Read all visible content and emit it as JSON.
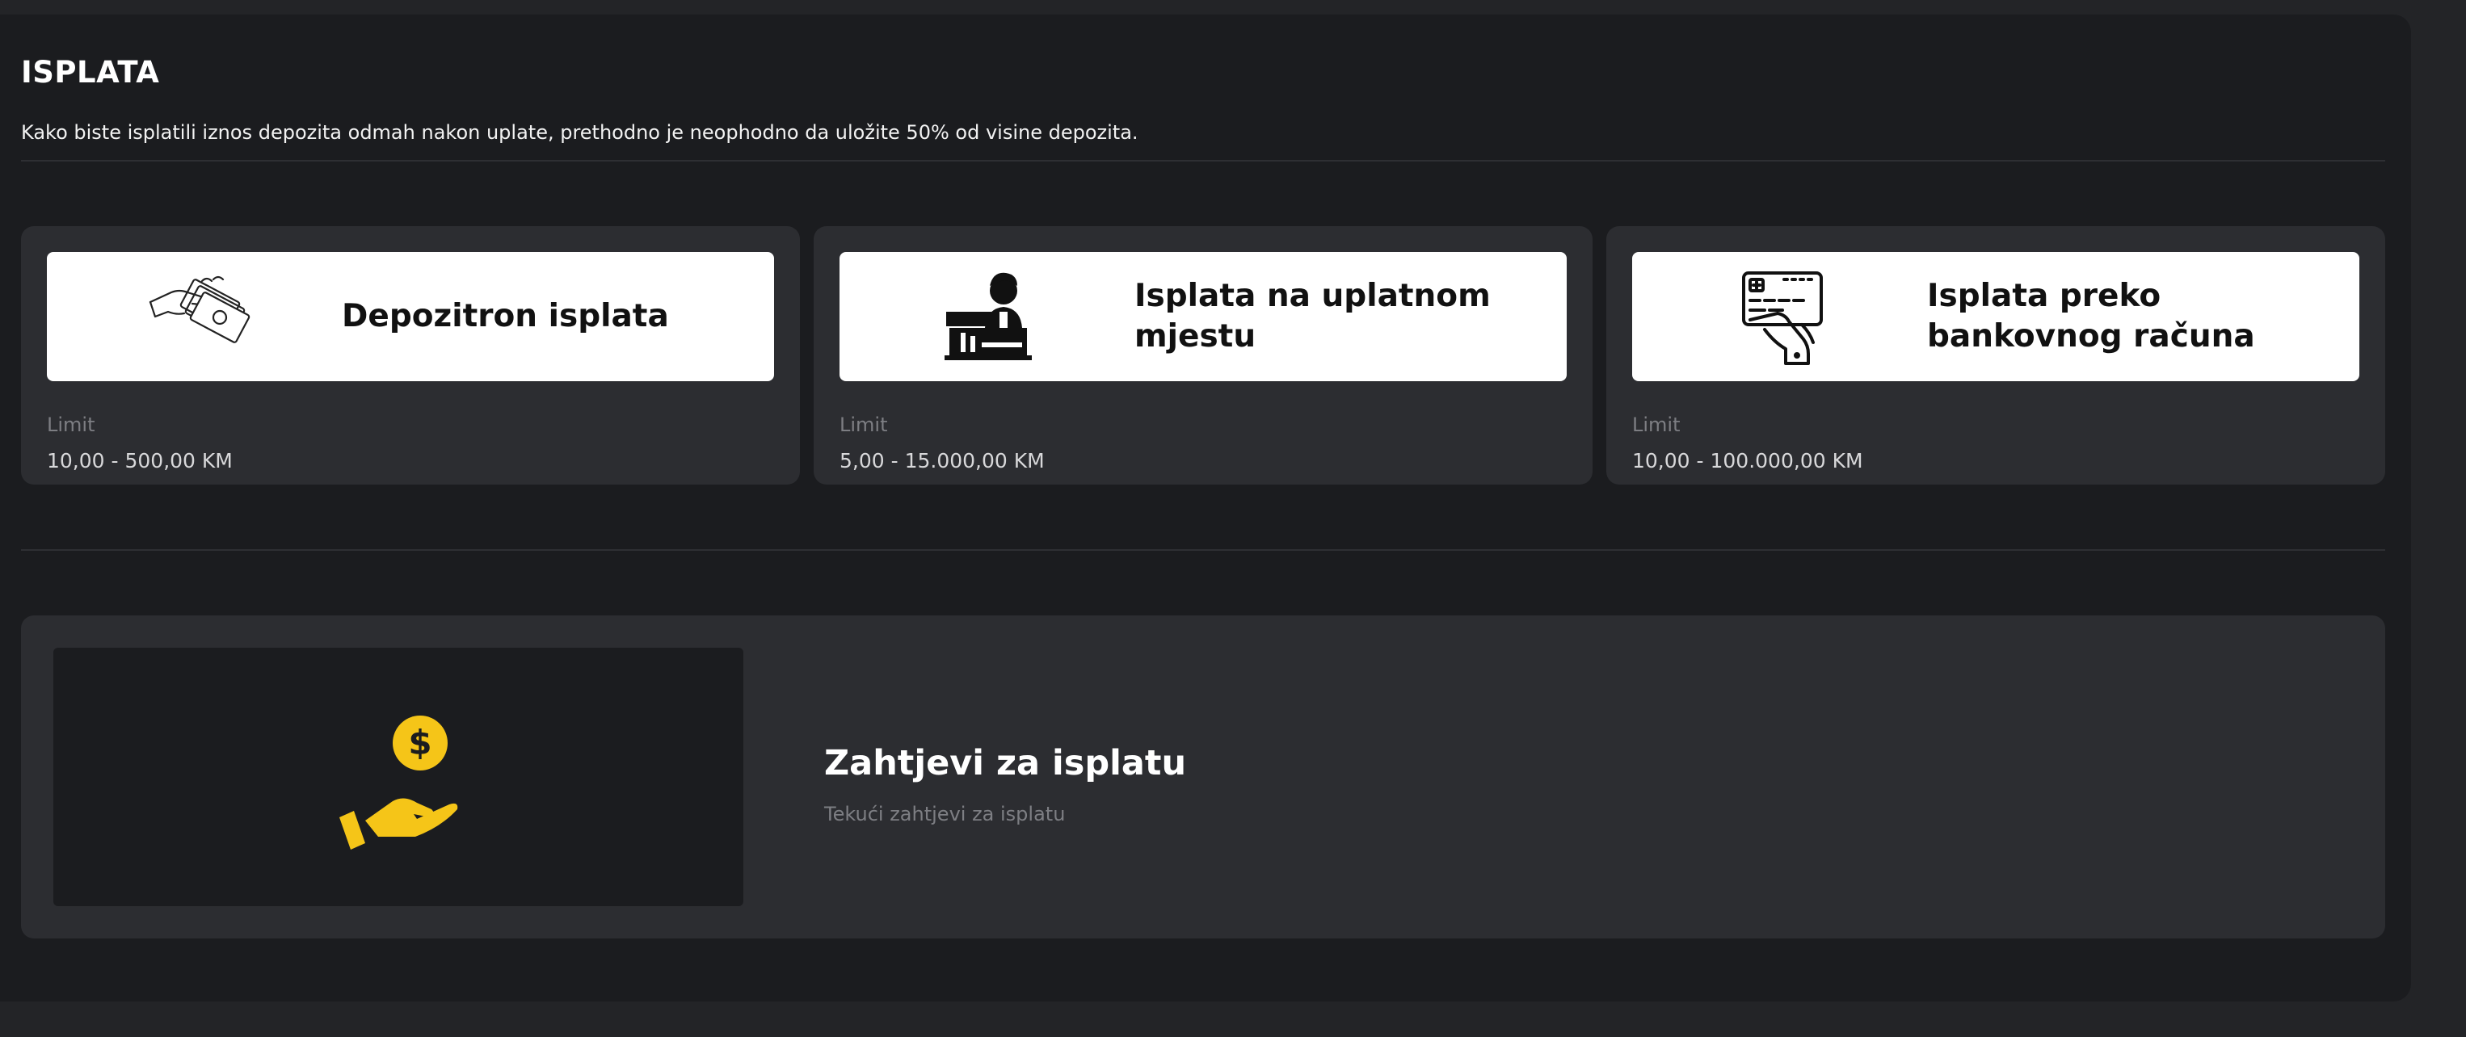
{
  "page": {
    "title": "ISPLATA",
    "description": "Kako biste isplatili iznos depozita odmah nakon uplate, prethodno je neophodno da uložite 50% od visine depozita."
  },
  "methods": [
    {
      "title": "Depozitron isplata",
      "icon": "hand-money-icon",
      "limit_label": "Limit",
      "limit_value": "10,00 - 500,00 KM"
    },
    {
      "title": "Isplata na uplatnom mjestu",
      "icon": "cashier-icon",
      "limit_label": "Limit",
      "limit_value": "5,00 - 15.000,00 KM"
    },
    {
      "title": "Isplata preko bankovnog računa",
      "icon": "hand-card-icon",
      "limit_label": "Limit",
      "limit_value": "10,00 - 100.000,00 KM"
    }
  ],
  "requests": {
    "title": "Zahtjevi za isplatu",
    "subtitle": "Tekući zahtjevi za isplatu",
    "icon": "hand-coin-icon",
    "accent_color": "#f5c518"
  }
}
